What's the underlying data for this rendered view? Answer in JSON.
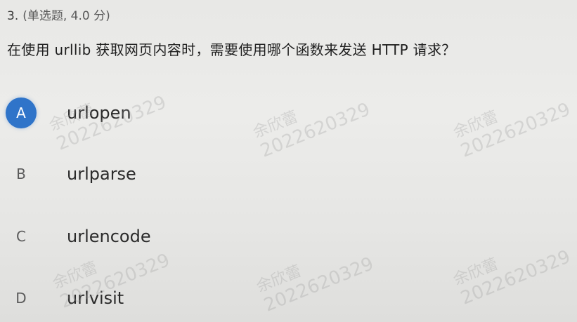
{
  "question": {
    "number": "3.",
    "meta": "(单选题, 4.0 分)",
    "text": "在使用 urllib 获取网页内容时，需要使用哪个函数来发送 HTTP 请求？"
  },
  "options": [
    {
      "letter": "A",
      "label": "urlopen",
      "selected": true
    },
    {
      "letter": "B",
      "label": "urlparse",
      "selected": false
    },
    {
      "letter": "C",
      "label": "urlencode",
      "selected": false
    },
    {
      "letter": "D",
      "label": "urlvisit",
      "selected": false
    }
  ],
  "watermark": {
    "name": "余欣蕾",
    "id": "2022620329"
  },
  "colors": {
    "selected_accent": "#2f74c9",
    "background": "#e8e8e6"
  }
}
